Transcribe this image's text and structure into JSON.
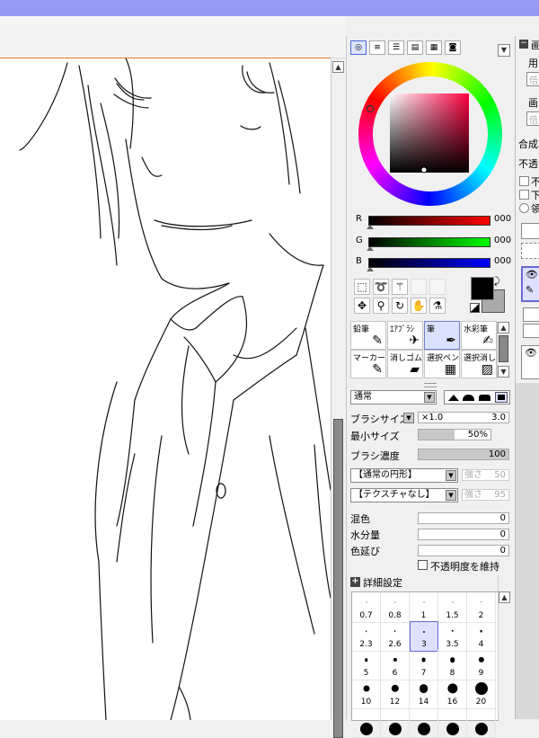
{
  "color_panel": {
    "tabs": [
      {
        "name": "color-wheel-tab",
        "glyph": "◎"
      },
      {
        "name": "rgb-sliders-tab",
        "glyph": "≡"
      },
      {
        "name": "hsv-sliders-tab",
        "glyph": "☰"
      },
      {
        "name": "color-set-tab",
        "glyph": "▤"
      },
      {
        "name": "swatch-tab",
        "glyph": "▦"
      },
      {
        "name": "scratchpad-tab",
        "glyph": "◙"
      }
    ],
    "r": {
      "label": "R",
      "value": "000"
    },
    "g": {
      "label": "G",
      "value": "000"
    },
    "b": {
      "label": "B",
      "value": "000"
    },
    "foreground": "#000000",
    "background": "#aaaaaa"
  },
  "brushes": [
    {
      "label": "鉛筆",
      "icon": "✎"
    },
    {
      "label": "ｴｱﾌﾞﾗｼ",
      "icon": "✈"
    },
    {
      "label": "筆",
      "icon": "✒",
      "active": true
    },
    {
      "label": "水彩筆",
      "icon": "✍"
    },
    {
      "label": "マーカー",
      "icon": "✎"
    },
    {
      "label": "消しゴム",
      "icon": "▰"
    },
    {
      "label": "選択ペン",
      "icon": "▦"
    },
    {
      "label": "選択消し",
      "icon": "▨"
    }
  ],
  "blend_mode": "通常",
  "brush_size": {
    "label": "ブラシサイズ",
    "multiplier": "×1.0",
    "value": "3.0"
  },
  "min_size": {
    "label": "最小サイズ",
    "value": "50%",
    "percent": 50
  },
  "density": {
    "label": "ブラシ濃度",
    "value": "100",
    "percent": 100
  },
  "shape": {
    "value": "【通常の円形】",
    "strength_label": "強さ",
    "strength": "50"
  },
  "texture": {
    "value": "【テクスチャなし】",
    "strength_label": "強さ",
    "strength": "95"
  },
  "mix": {
    "label": "混色",
    "value": "0"
  },
  "water": {
    "label": "水分量",
    "value": "0"
  },
  "stretch": {
    "label": "色延び",
    "value": "0"
  },
  "keep_opacity": "不透明度を維持",
  "detail_settings": "詳細設定",
  "brush_sizes": [
    "0.7",
    "0.8",
    "1",
    "1.5",
    "2",
    "2.3",
    "2.6",
    "3",
    "3.5",
    "4",
    "5",
    "6",
    "7",
    "8",
    "9",
    "10",
    "12",
    "14",
    "16",
    "20",
    "",
    "",
    "",
    "",
    ""
  ],
  "selected_size": "3",
  "right_panel": {
    "title_fragment": "画",
    "use_fragment": "用",
    "mag_fragment": "倍",
    "layer_fragment": "画",
    "mag2_fragment": "倍",
    "blend_fragment": "合成",
    "opacity_fragment": "不透",
    "check1_fragment": "不",
    "check2_fragment": "下",
    "radio_fragment": "領"
  }
}
